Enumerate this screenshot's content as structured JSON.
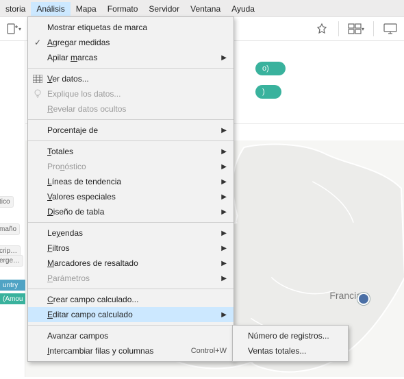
{
  "menubar": {
    "items": [
      "storia",
      "Análisis",
      "Mapa",
      "Formato",
      "Servidor",
      "Ventana",
      "Ayuda"
    ],
    "activeIndex": 1
  },
  "toolbar": {
    "pinTip": "Pin",
    "dashTip": "Dashboard",
    "presentTip": "Present"
  },
  "shelf": {
    "pill1_suffix": "o)",
    "pill2_suffix": ")"
  },
  "sidebar": {
    "chip_tico": "tico",
    "chip_mano": "maño",
    "chip_crip": "crip…",
    "chip_erge": "erge…",
    "pill_ntry": "untry",
    "pill_amou": "(Amou"
  },
  "map": {
    "label": "Francia"
  },
  "menu": {
    "mostrar": "Mostrar etiquetas de marca",
    "agregar_pre": "A",
    "agregar_rest": "gregar medidas",
    "apilar_pre": "Apilar ",
    "apilar_u": "m",
    "apilar_rest": "arcas",
    "ver_u": "V",
    "ver_rest": "er datos...",
    "explique": "Explique los datos...",
    "revelar_u": "R",
    "revelar_rest": "evelar datos ocultos",
    "porcentaje": "Porcentaje de",
    "totales_u": "T",
    "totales_rest": "otales",
    "pronostico_pre": "Pro",
    "pronostico_u": "n",
    "pronostico_rest": "óstico",
    "lineas_u": "L",
    "lineas_rest": "íneas de tendencia",
    "valores_u": "V",
    "valores_rest": "alores especiales",
    "diseno_u": "D",
    "diseno_rest": "iseño de tabla",
    "leyendas_pre": "Le",
    "leyendas_u": "y",
    "leyendas_rest": "endas",
    "filtros_u": "F",
    "filtros_rest": "iltros",
    "marcadores_u": "M",
    "marcadores_rest": "arcadores de resaltado",
    "parametros_u": "P",
    "parametros_rest": "arámetros",
    "crear_u": "C",
    "crear_rest": "rear campo calculado...",
    "editar_u": "E",
    "editar_rest": "ditar campo calculado",
    "avanzar": "Avanzar campos",
    "intercambiar_u": "I",
    "intercambiar_rest": "ntercambiar filas y columnas",
    "shortcut_swap": "Control+W"
  },
  "submenu": {
    "numreg": "Número de registros...",
    "ventas": "Ventas totales..."
  }
}
